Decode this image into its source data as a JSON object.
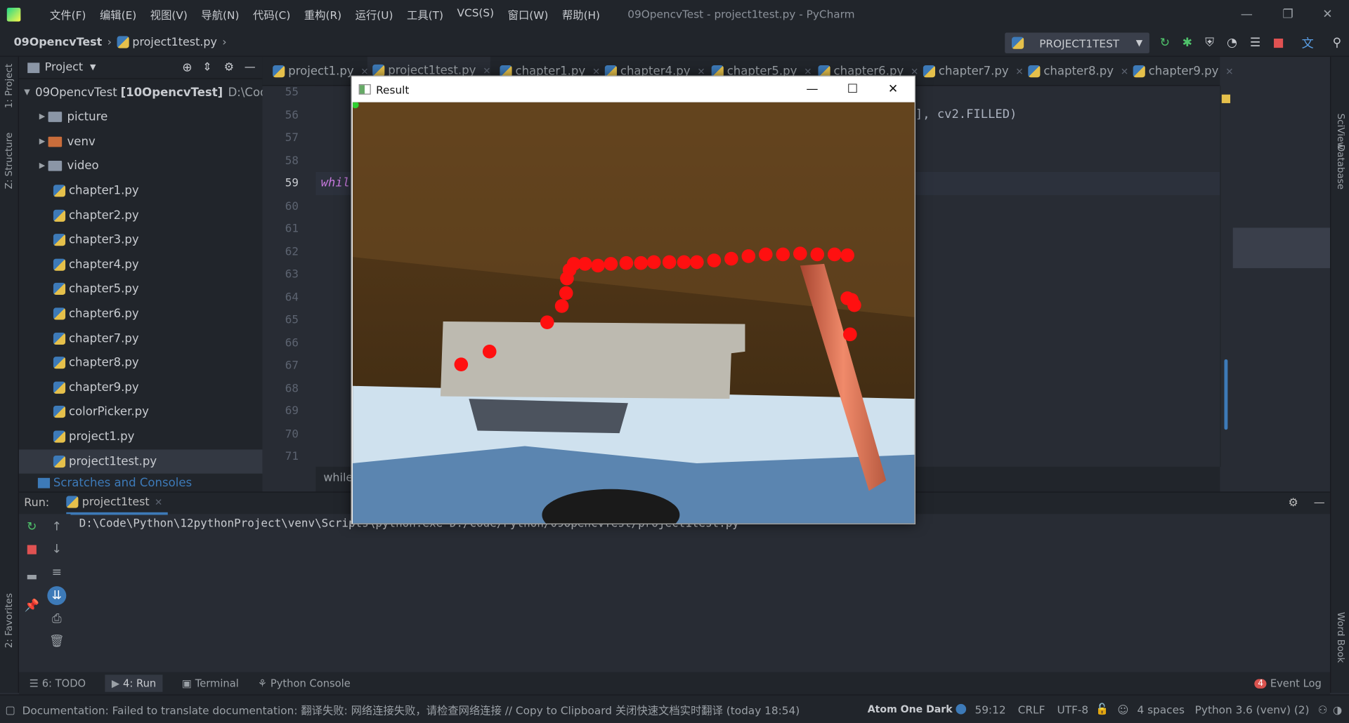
{
  "window": {
    "title": "09OpencvTest - project1test.py - PyCharm",
    "menu": [
      "文件(F)",
      "编辑(E)",
      "视图(V)",
      "导航(N)",
      "代码(C)",
      "重构(R)",
      "运行(U)",
      "工具(T)",
      "VCS(S)",
      "窗口(W)",
      "帮助(H)"
    ]
  },
  "nav": {
    "project": "09OpencvTest",
    "file": "project1test.py"
  },
  "run_config": "PROJECT1TEST",
  "project_panel": {
    "title": "Project",
    "root_name": "09OpencvTest",
    "root_module": "[10OpencvTest]",
    "root_path": "D:\\Code\\",
    "folders": [
      "picture",
      "venv",
      "video"
    ],
    "files": [
      "chapter1.py",
      "chapter2.py",
      "chapter3.py",
      "chapter4.py",
      "chapter5.py",
      "chapter6.py",
      "chapter7.py",
      "chapter8.py",
      "chapter9.py",
      "colorPicker.py",
      "project1.py",
      "project1test.py"
    ],
    "scratches": "Scratches and Consoles"
  },
  "left_tools": [
    "1: Project",
    "Z: Structure",
    "2: Favorites"
  ],
  "right_tools": [
    "SciView",
    "Database",
    "Word Book"
  ],
  "tabs": [
    "project1.py",
    "project1test.py",
    "chapter1.py",
    "chapter4.py",
    "chapter5.py",
    "chapter6.py",
    "chapter7.py",
    "chapter8.py",
    "chapter9.py"
  ],
  "editor": {
    "line_numbers": [
      "55",
      "56",
      "57",
      "58",
      "59",
      "60",
      "61",
      "62",
      "63",
      "64",
      "65",
      "66",
      "67",
      "68",
      "69",
      "70",
      "71"
    ],
    "current_line": "59",
    "code_while": "whil",
    "code_tail": "], cv2.FILLED)",
    "breadcrumb": "while"
  },
  "run_panel": {
    "label": "Run:",
    "tab": "project1test",
    "command": "D:\\Code\\Python\\12pythonProject\\venv\\Scripts\\python.exe D:/Code/Python/09OpencvTest/project1test.py"
  },
  "bottom_tools": [
    "6: TODO",
    "4: Run",
    "Terminal",
    "Python Console"
  ],
  "event_log": {
    "count": "4",
    "label": "Event Log"
  },
  "status": {
    "message": "Documentation: Failed to translate documentation: 翻译失败: 网络连接失败，请检查网络连接 // Copy to Clipboard   关闭快速文档实时翻译 (today 18:54)",
    "theme": "Atom One Dark",
    "position": "59:12",
    "line_sep": "CRLF",
    "encoding": "UTF-8",
    "indent": "4 spaces",
    "interpreter": "Python 3.6 (venv) (2)"
  },
  "result_window": {
    "title": "Result"
  },
  "colors": {
    "accent": "#3d7ab8",
    "dot": "#ff1010",
    "bg": "#282c34"
  }
}
